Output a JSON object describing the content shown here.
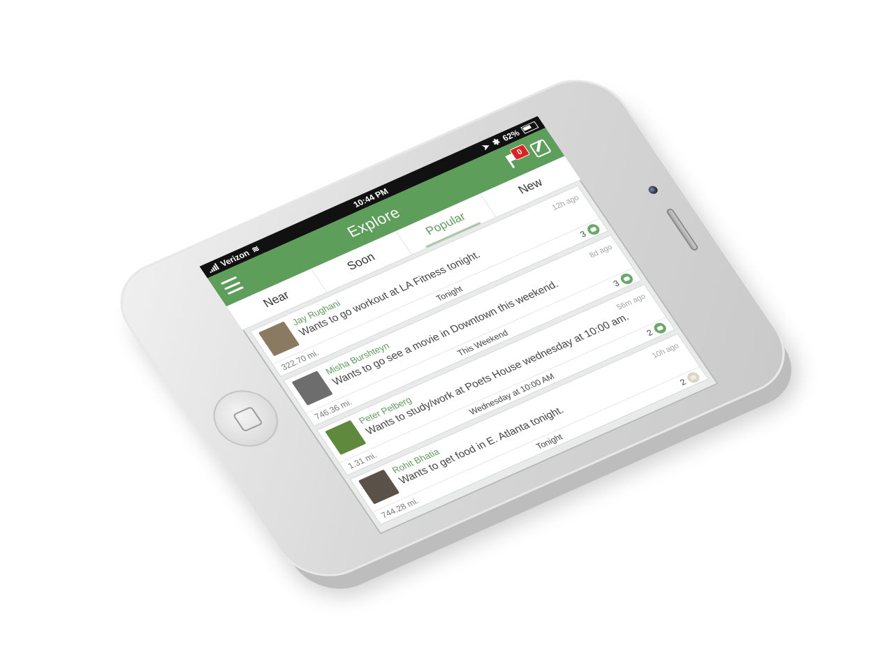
{
  "status_bar": {
    "carrier": "Verizon",
    "time": "10:44 PM",
    "battery": "62%"
  },
  "header": {
    "title": "Explore",
    "notification_count": "0"
  },
  "tabs": [
    {
      "label": "Near",
      "active": false
    },
    {
      "label": "Soon",
      "active": false
    },
    {
      "label": "Popular",
      "active": true
    },
    {
      "label": "New",
      "active": false
    }
  ],
  "feed": [
    {
      "name": "Jay Rughani",
      "text": "Wants to go workout at LA Fitness tonight.",
      "distance": "322.70 mi.",
      "when": "Tonight",
      "ago": "12h ago",
      "count": "3",
      "avatar_color": "#8a7a62"
    },
    {
      "name": "Misha Burshteyn",
      "text": "Wants to go see a movie in Downtown this weekend.",
      "distance": "746.36 mi.",
      "when": "This Weekend",
      "ago": "8d ago",
      "count": "3",
      "avatar_color": "#6d6d6d"
    },
    {
      "name": "Peter Pelberg",
      "text": "Wants to study/work at Poets House wednesday at 10:00 am.",
      "distance": "1.31 mi.",
      "when": "Wednesday at 10:00 AM",
      "ago": "56m ago",
      "count": "2",
      "avatar_color": "#5f8a3e"
    },
    {
      "name": "Rohit Bhatia",
      "text": "Wants to get food in E. Atlanta tonight.",
      "distance": "744.28 mi.",
      "when": "Tonight",
      "ago": "10h ago",
      "count": "2",
      "avatar_color": "#5a5148"
    }
  ],
  "colors": {
    "brand_green": "#5d9e5a",
    "badge_red": "#e02121",
    "status_bar": "#111111"
  },
  "icons": {
    "menu": "hamburger-menu-icon",
    "notifications": "flag-icon",
    "compose": "compose-icon",
    "join": "join-icon",
    "home": "home-button-icon"
  }
}
